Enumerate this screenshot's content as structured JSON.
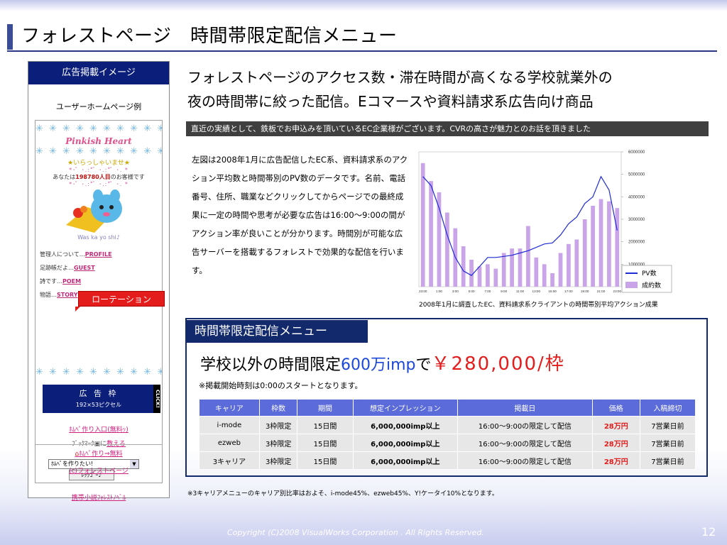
{
  "slide": {
    "title": "フォレストページ　時間帯限定配信メニュー",
    "footer": "Copyright (C)2008   VisualWorks Corporation . All Rights Reserved.",
    "page_number": "12"
  },
  "mockup": {
    "header": "広告掲載イメージ",
    "subtitle": "ユーザーホームページ例",
    "stars_line": "✳ ✳ ✳ ✳ ✳ ✳ ✳ ✳ ✳ ✳",
    "site_name": "Pinkish Heart",
    "welcome": "★いらっしゃいませ★",
    "dots": "*･ﾟ ･.:*ﾟ ･.:*ﾟ ･. *",
    "visitor_prefix": "あなたは",
    "visitor_count": "198780人目",
    "visitor_suffix": "のお客様です",
    "wkw": "Was ka yo shi♪",
    "links": [
      {
        "prefix": "管理人について…",
        "link": "PROFILE"
      },
      {
        "prefix": "足跡帳だよ…",
        "link": "GUEST"
      },
      {
        "prefix": "詩です…",
        "link": "POEM"
      },
      {
        "prefix": "物語…",
        "link": "STORY"
      }
    ],
    "rotation_label": "ローテーション",
    "ad_title": "広 告 枠",
    "ad_size": "192×53ピクセル",
    "ad_click": "CLICK!",
    "link_free": "ﾎﾑﾍﾟ作り入口(無料ｯ)",
    "bookmark_prefix": "ﾌﾞｯｸﾏｰｸ",
    "bookmark_mid": "に",
    "bookmark_link": "教える",
    "select_value": "ﾎﾑﾍﾟを作りたい!",
    "button_label": "ﾚｯﾂｺﾞｰ♪",
    "link_novel": "携帯小説ﾌｫﾚｽﾄﾉﾍﾞﾙ",
    "link_make": "ﾎﾑﾍﾟ作り⇒無料",
    "link_copyright": "(c)フォレストページ"
  },
  "headline": {
    "line1": "フォレストページのアクセス数・滞在時間が高くなる学校就業外の",
    "line2": "夜の時間帯に絞った配信。Eコマースや資料請求系広告向け商品"
  },
  "dark_bar": "直近の実績として、鉄板でお申込みを頂いているEC企業様がございます。CVRの高さが魅力とのお話を頂きました",
  "description": "左図は2008年1月に広告配信したEC系、資料請求系のアクション平均数と時間帯別のPV数のデータです。名前、電話番号、住所、職業などクリックしてからページでの最終成果に一定の時間や思考が必要な広告は16:00～9:00の間がアクション率が良いことが分かります。時間別が可能な広告サーバーを搭載するフォレストで効果的な配信を行います。",
  "chart_caption": "2008年1月に調査したEC、資料請求系クライアントの時間帯別平均アクション成果",
  "chart_data": {
    "type": "bar",
    "categories": [
      "23:00",
      "0:00",
      "1:00",
      "2:00",
      "3:00",
      "4:00",
      "5:00",
      "6:00",
      "7:00",
      "8:00",
      "9:00",
      "10:00",
      "11:00",
      "12:00",
      "13:00",
      "14:00",
      "15:00",
      "16:00",
      "17:00",
      "18:00",
      "19:00",
      "20:00",
      "21:00",
      "22:00",
      "23:00"
    ],
    "x_tick_labels": [
      "23:00",
      "1:00",
      "3:00",
      "5:00",
      "7:00",
      "9:00",
      "11:00",
      "13:00",
      "15:00",
      "17:00",
      "19:00",
      "21:00",
      "23:00"
    ],
    "series": [
      {
        "name": "成約数",
        "type": "bar",
        "color": "#c9a4e8",
        "values": [
          5500000,
          4700000,
          4200000,
          3300000,
          2600000,
          1800000,
          1200000,
          900000,
          1000000,
          800000,
          1500000,
          1700000,
          1700000,
          2700000,
          1300000,
          1000000,
          600000,
          1500000,
          1900000,
          2100000,
          3000000,
          3600000,
          3900000,
          3800000,
          3500000
        ]
      },
      {
        "name": "PV数",
        "type": "line",
        "color": "#1d2bd6",
        "values": [
          4900000,
          4500000,
          3500000,
          2300000,
          1300000,
          700000,
          500000,
          900000,
          1300000,
          1300000,
          1350000,
          1400000,
          1500000,
          1600000,
          1750000,
          1900000,
          1950000,
          2300000,
          2800000,
          3100000,
          3700000,
          4000000,
          4900000,
          4300000,
          2500000
        ]
      }
    ],
    "y_ticks": [
      "1000000",
      "2000000",
      "3000000",
      "4000000",
      "5000000",
      "6000000"
    ],
    "ylim": [
      0,
      6000000
    ],
    "legend_position": "bottom-right"
  },
  "menu": {
    "tab_title": "時間帯限定配信メニュー",
    "big_prefix": "学校以外の時間限定",
    "big_amount": "600万imp",
    "big_mid": "で",
    "big_price": "￥280,000/枠",
    "note_start": "※掲載開始時刻は0:00のスタートとなります。",
    "columns": [
      "キャリア",
      "枠数",
      "期間",
      "想定インプレッション",
      "掲載日",
      "価格",
      "入稿締切"
    ],
    "rows": [
      [
        "i-mode",
        "3枠限定",
        "15日間",
        "6,000,000imp以上",
        "16:00～9:00の限定して配信",
        "28万円",
        "7営業日前"
      ],
      [
        "ezweb",
        "3枠限定",
        "15日間",
        "6,000,000imp以上",
        "16:00～9:00の限定して配信",
        "28万円",
        "7営業日前"
      ],
      [
        "3キャリア",
        "3枠限定",
        "15日間",
        "6,000,000imp以上",
        "16:00～9:00の限定して配信",
        "28万円",
        "7営業日前"
      ]
    ],
    "footnote": "※3キャリアメニューのキャリア別比率はおよそ、i-mode45%、ezweb45%、Y!ケータイ10%となります。"
  }
}
